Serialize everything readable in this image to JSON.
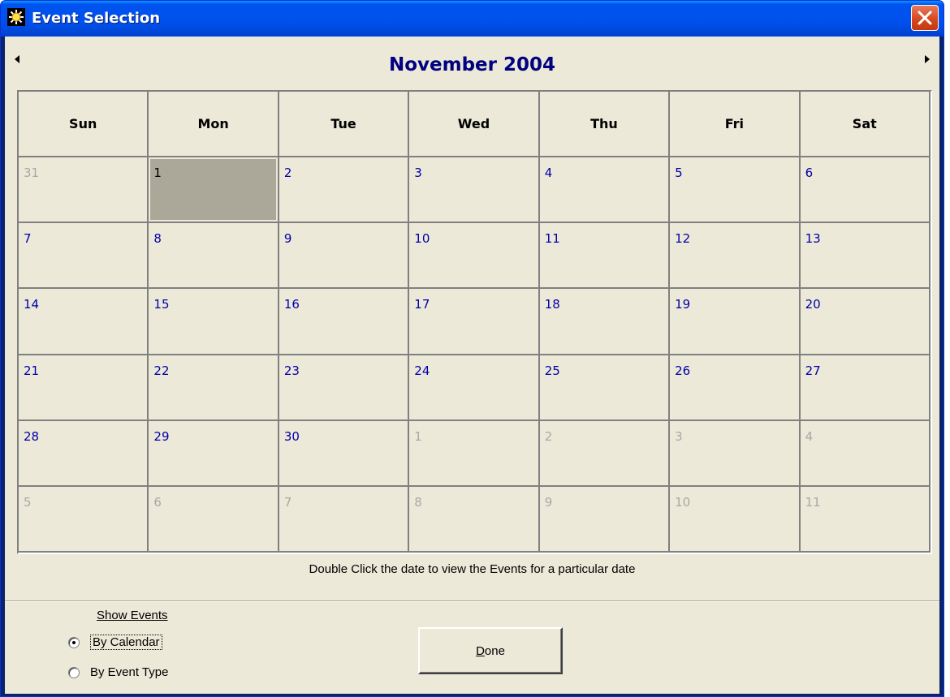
{
  "window": {
    "title": "Event Selection",
    "accent": "#0053ee"
  },
  "calendar": {
    "month_title": "November 2004",
    "weekdays": [
      "Sun",
      "Mon",
      "Tue",
      "Wed",
      "Thu",
      "Fri",
      "Sat"
    ],
    "selected_day": "1",
    "weeks": [
      [
        {
          "d": "31",
          "cur": false
        },
        {
          "d": "1",
          "cur": true,
          "sel": true
        },
        {
          "d": "2",
          "cur": true
        },
        {
          "d": "3",
          "cur": true
        },
        {
          "d": "4",
          "cur": true
        },
        {
          "d": "5",
          "cur": true
        },
        {
          "d": "6",
          "cur": true
        }
      ],
      [
        {
          "d": "7",
          "cur": true
        },
        {
          "d": "8",
          "cur": true
        },
        {
          "d": "9",
          "cur": true
        },
        {
          "d": "10",
          "cur": true
        },
        {
          "d": "11",
          "cur": true
        },
        {
          "d": "12",
          "cur": true
        },
        {
          "d": "13",
          "cur": true
        }
      ],
      [
        {
          "d": "14",
          "cur": true
        },
        {
          "d": "15",
          "cur": true
        },
        {
          "d": "16",
          "cur": true
        },
        {
          "d": "17",
          "cur": true
        },
        {
          "d": "18",
          "cur": true
        },
        {
          "d": "19",
          "cur": true
        },
        {
          "d": "20",
          "cur": true
        }
      ],
      [
        {
          "d": "21",
          "cur": true
        },
        {
          "d": "22",
          "cur": true
        },
        {
          "d": "23",
          "cur": true
        },
        {
          "d": "24",
          "cur": true
        },
        {
          "d": "25",
          "cur": true
        },
        {
          "d": "26",
          "cur": true
        },
        {
          "d": "27",
          "cur": true
        }
      ],
      [
        {
          "d": "28",
          "cur": true
        },
        {
          "d": "29",
          "cur": true
        },
        {
          "d": "30",
          "cur": true
        },
        {
          "d": "1",
          "cur": false
        },
        {
          "d": "2",
          "cur": false
        },
        {
          "d": "3",
          "cur": false
        },
        {
          "d": "4",
          "cur": false
        }
      ],
      [
        {
          "d": "5",
          "cur": false
        },
        {
          "d": "6",
          "cur": false
        },
        {
          "d": "7",
          "cur": false
        },
        {
          "d": "8",
          "cur": false
        },
        {
          "d": "9",
          "cur": false
        },
        {
          "d": "10",
          "cur": false
        },
        {
          "d": "11",
          "cur": false
        }
      ]
    ],
    "colors": {
      "current_month": "#0000a8",
      "other_month": "#a8a8a8",
      "selected_bg": "#aca899"
    }
  },
  "hint": "Double Click the date to view the Events for a particular date",
  "show_events": {
    "label": "Show Events",
    "options": [
      {
        "label": "By Calendar",
        "checked": true
      },
      {
        "label": "By Event Type",
        "checked": false
      }
    ]
  },
  "done_button": {
    "mnemonic": "D",
    "rest": "one"
  },
  "icons": {
    "app": "sun-icon",
    "close": "close-icon",
    "prev": "prev-month-icon",
    "next": "next-month-icon"
  }
}
